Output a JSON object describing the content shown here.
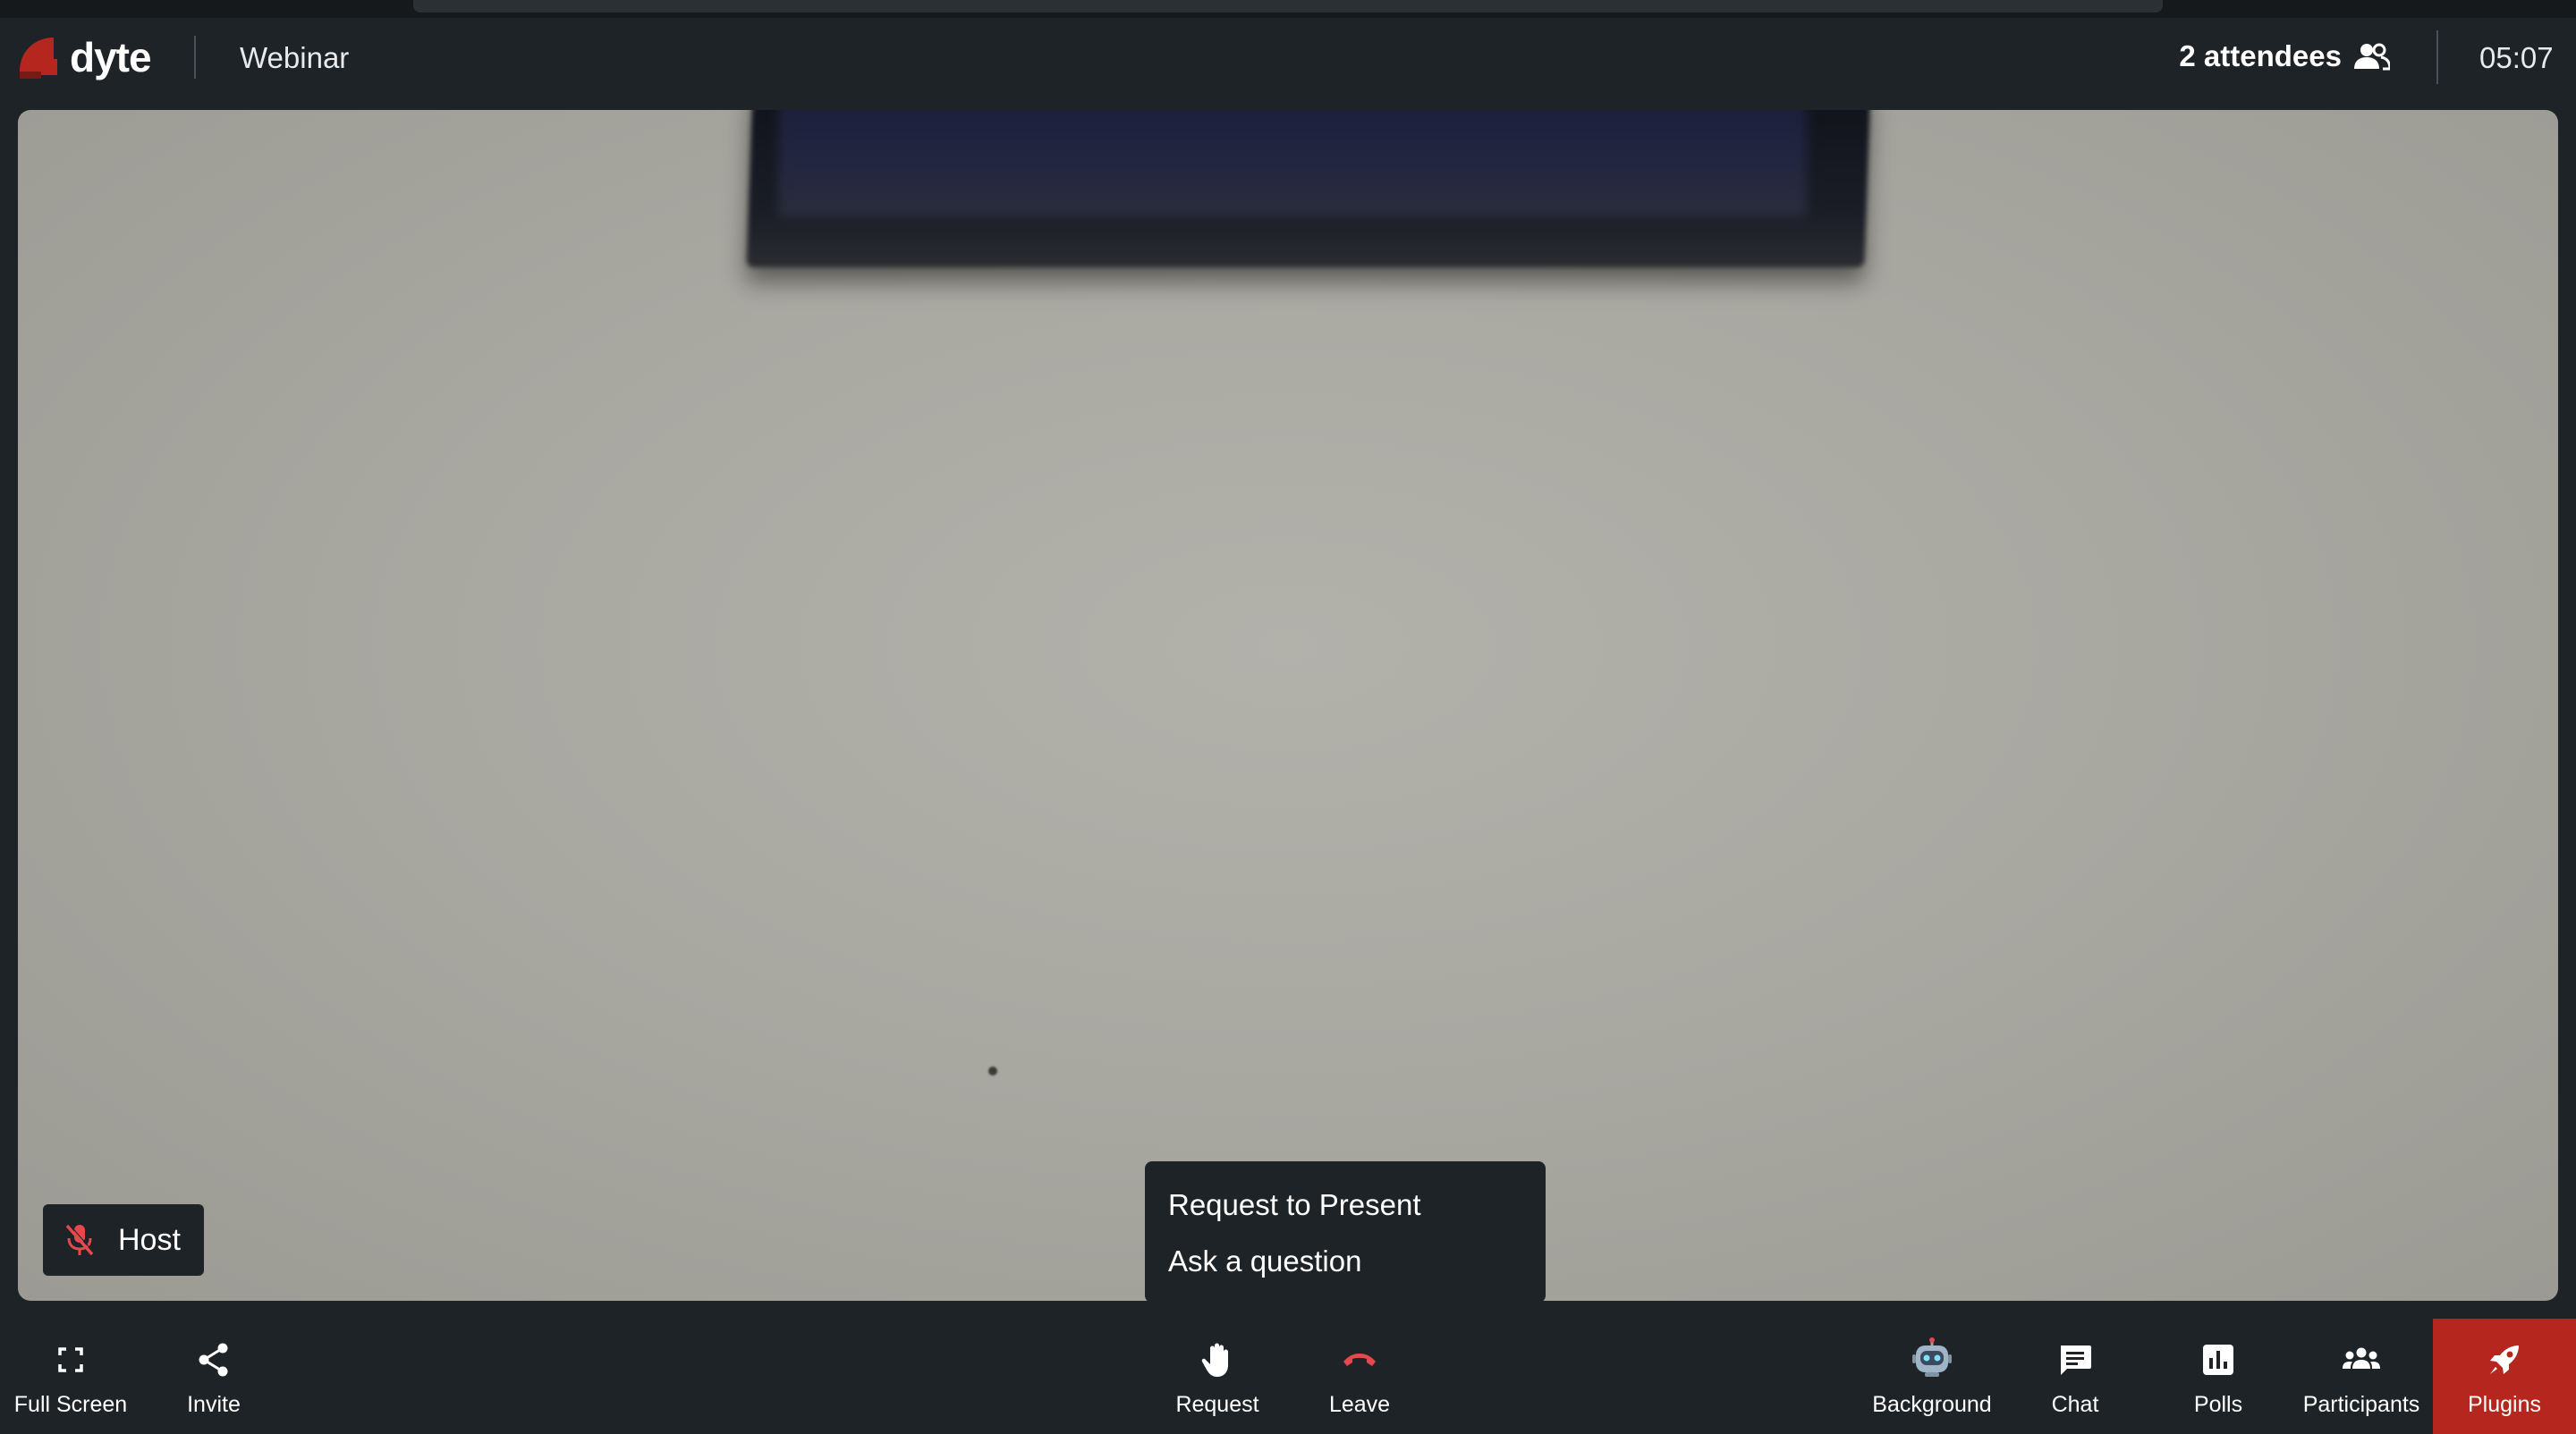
{
  "header": {
    "logo_text": "dyte",
    "meeting_title": "Webinar",
    "attendees_label": "2 attendees",
    "clock": "05:07"
  },
  "stage": {
    "host_name": "Host"
  },
  "request_menu": {
    "items": [
      "Request to Present",
      "Ask a question"
    ]
  },
  "controls": {
    "left": [
      {
        "label": "Full Screen",
        "icon": "fullscreen-icon"
      },
      {
        "label": "Invite",
        "icon": "share-icon"
      }
    ],
    "center": [
      {
        "label": "Request",
        "icon": "raise-hand-icon"
      },
      {
        "label": "Leave",
        "icon": "hang-up-icon"
      }
    ],
    "right": [
      {
        "label": "Background",
        "icon": "robot-icon"
      },
      {
        "label": "Chat",
        "icon": "chat-icon"
      },
      {
        "label": "Polls",
        "icon": "poll-icon"
      },
      {
        "label": "Participants",
        "icon": "participants-icon"
      },
      {
        "label": "Plugins",
        "icon": "rocket-icon"
      }
    ]
  },
  "colors": {
    "background": "#1e2327",
    "brand_red": "#b5261e",
    "leave_red": "#e5484d",
    "plugins_active_bg": "#b5261e"
  }
}
